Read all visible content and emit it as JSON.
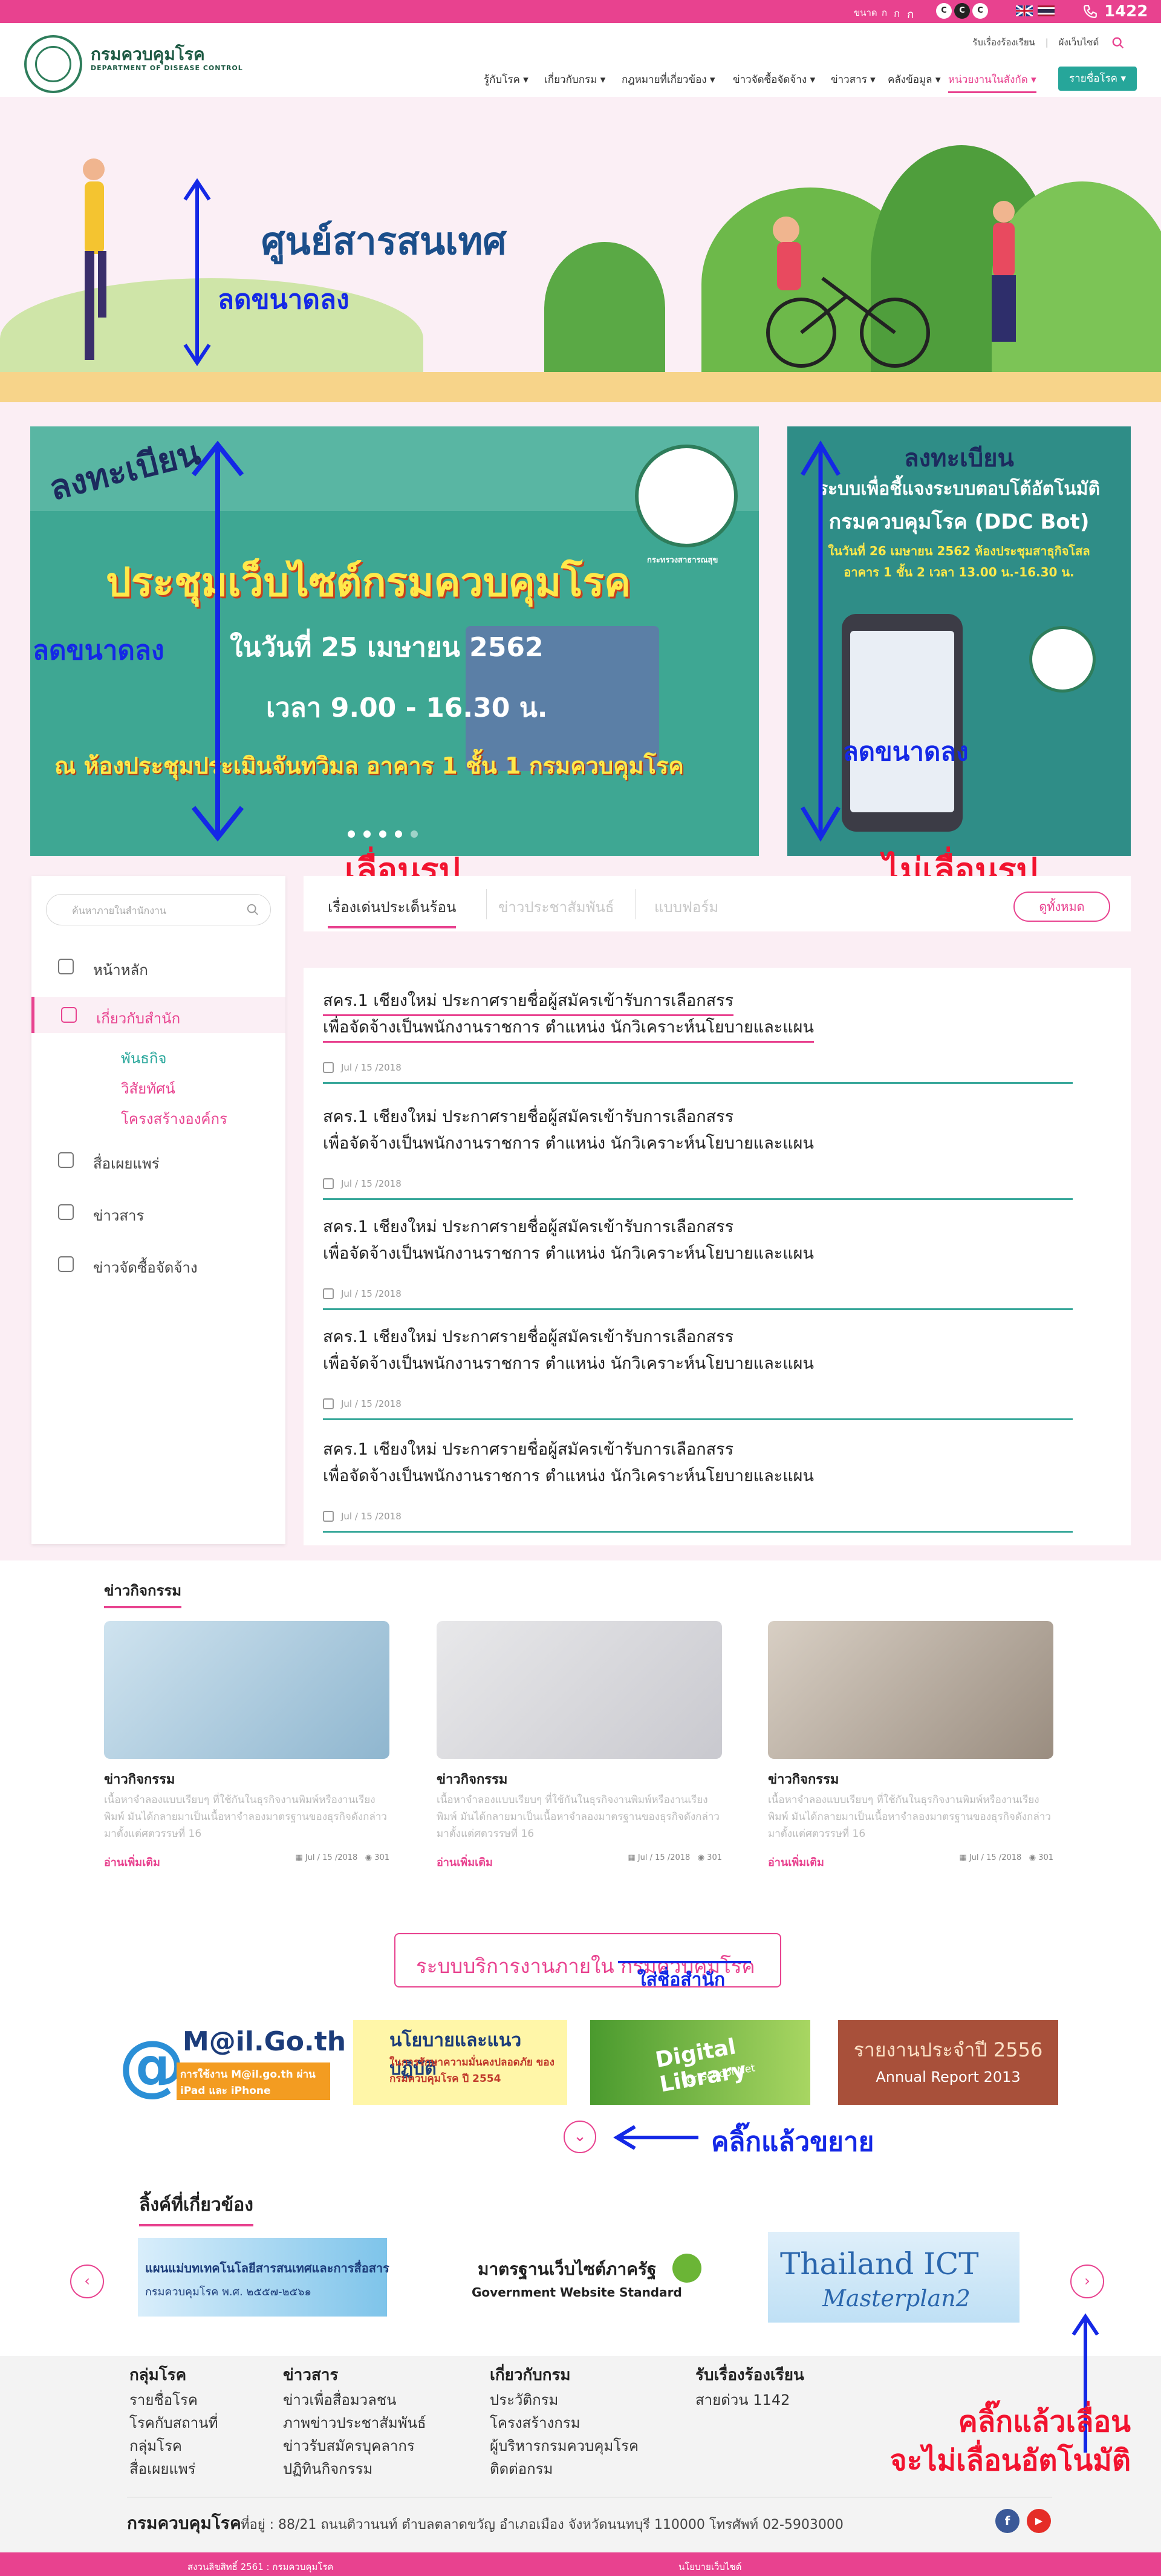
{
  "topbar": {
    "font_size_label": "ขนาด",
    "font_a1": "ก",
    "font_a2": "ก",
    "font_a3": "ก",
    "hotline": "1422",
    "colors": {
      "bar": "#e8428f"
    }
  },
  "header": {
    "logo_th": "กรมควบคุมโรค",
    "logo_en": "DEPARTMENT OF DISEASE CONTROL",
    "link_complaint": "รับเรื่องร้องเรียน",
    "link_sitemap": "ผังเว็บไซต์",
    "nav": [
      "รู้กับโรค",
      "เกี่ยวกับกรม",
      "กฎหมายที่เกี่ยวข้อง",
      "ข่าวจัดซื้อจัดจ้าง",
      "ข่าวสาร",
      "คลังข้อมูล",
      "หน่วยงานในสังกัด"
    ],
    "nav_button": "รายชื่อโรค"
  },
  "hero": {
    "title": "ศูนย์สารสนเทศ",
    "annotation": "ลดขนาดลง"
  },
  "banner_main": {
    "register": "ลงทะเบียน",
    "title": "ประชุมเว็บไซต์กรมควบคุมโรค",
    "date": "ในวันที่ 25 เมษายน 2562",
    "time": "เวลา 9.00 - 16.30 น.",
    "place": "ณ ห้องประชุมประเมินจันทวิมล อาคาร 1 ชั้น 1 กรมควบคุมโรค",
    "seal_text": "กระทรวงสาธารณสุข",
    "annotation_left": "ลดขนาดลง",
    "annotation_below": "เลื่อนรูป"
  },
  "banner_side": {
    "line1": "ลงทะเบียน",
    "line2": "ระบบเพื่อชี้แจงระบบตอบโต้อัตโนมัติ",
    "line3": "กรมควบคุมโรค (DDC Bot)",
    "line4": "ในวันที่ 26 เมษายน 2562 ห้องประชุมสาธุกิจโสล",
    "line5": "อาคาร 1 ชั้น 2 เวลา 13.00 น.-16.30 น.",
    "annotation_mid": "ลดขนาดลง",
    "annotation_below": "ไม่เลื่อนรูป"
  },
  "sidebar": {
    "search_placeholder": "ค้นหาภายในสำนักงาน",
    "items": [
      {
        "label": "หน้าหลัก",
        "icon": "home-icon"
      },
      {
        "label": "เกี่ยวกับสำนัก",
        "icon": "document-icon",
        "active": true
      },
      {
        "label": "สื่อเผยแพร่",
        "icon": "media-icon"
      },
      {
        "label": "ข่าวสาร",
        "icon": "news-icon"
      },
      {
        "label": "ข่าวจัดซื้อจัดจ้าง",
        "icon": "clipboard-icon"
      }
    ],
    "subitems": [
      "พันธกิจ",
      "วิสัยทัศน์",
      "โครงสร้างองค์กร"
    ]
  },
  "tabs": {
    "items": [
      "เรื่องเด่นประเด็นร้อน",
      "ข่าวประชาสัมพันธ์",
      "แบบฟอร์ม"
    ],
    "see_all": "ดูทั้งหมด"
  },
  "news": [
    {
      "line1": "สคร.1 เชียงใหม่ ประกาศรายชื่อผู้สมัครเข้ารับการเลือกสรร",
      "line2": "เพื่อจัดจ้างเป็นพนักงานราชการ ตำแหน่ง นักวิเคราะห์นโยบายและแผน",
      "date": "Jul / 15 /2018"
    },
    {
      "line1": "สคร.1 เชียงใหม่ ประกาศรายชื่อผู้สมัครเข้ารับการเลือกสรร",
      "line2": "เพื่อจัดจ้างเป็นพนักงานราชการ ตำแหน่ง นักวิเคราะห์นโยบายและแผน",
      "date": "Jul / 15 /2018"
    },
    {
      "line1": "สคร.1 เชียงใหม่ ประกาศรายชื่อผู้สมัครเข้ารับการเลือกสรร",
      "line2": "เพื่อจัดจ้างเป็นพนักงานราชการ ตำแหน่ง นักวิเคราะห์นโยบายและแผน",
      "date": "Jul / 15 /2018"
    },
    {
      "line1": "สคร.1 เชียงใหม่ ประกาศรายชื่อผู้สมัครเข้ารับการเลือกสรร",
      "line2": "เพื่อจัดจ้างเป็นพนักงานราชการ ตำแหน่ง นักวิเคราะห์นโยบายและแผน",
      "date": "Jul / 15 /2018"
    },
    {
      "line1": "สคร.1 เชียงใหม่ ประกาศรายชื่อผู้สมัครเข้ารับการเลือกสรร",
      "line2": "เพื่อจัดจ้างเป็นพนักงานราชการ ตำแหน่ง นักวิเคราะห์นโยบายและแผน",
      "date": "Jul / 15 /2018"
    }
  ],
  "activities": {
    "section_title": "ข่าวกิจกรรม",
    "cards": [
      {
        "title": "ข่าวกิจกรรม",
        "desc": "เนื้อหาจำลองแบบเรียบๆ ที่ใช้กันในธุรกิจงานพิมพ์หรืองานเรียงพิมพ์ มันได้กลายมาเป็นเนื้อหาจำลองมาตรฐานของธุรกิจดังกล่าวมาตั้งแต่ศตวรรษที่ 16",
        "more": "อ่านเพิ่มเติม",
        "date": "Jul / 15 /2018",
        "views": "301"
      },
      {
        "title": "ข่าวกิจกรรม",
        "desc": "เนื้อหาจำลองแบบเรียบๆ ที่ใช้กันในธุรกิจงานพิมพ์หรืองานเรียงพิมพ์ มันได้กลายมาเป็นเนื้อหาจำลองมาตรฐานของธุรกิจดังกล่าวมาตั้งแต่ศตวรรษที่ 16",
        "more": "อ่านเพิ่มเติม",
        "date": "Jul / 15 /2018",
        "views": "301"
      },
      {
        "title": "ข่าวกิจกรรม",
        "desc": "เนื้อหาจำลองแบบเรียบๆ ที่ใช้กันในธุรกิจงานพิมพ์หรืองานเรียงพิมพ์ มันได้กลายมาเป็นเนื้อหาจำลองมาตรฐานของธุรกิจดังกล่าวมาตั้งแต่ศตวรรษที่ 16",
        "more": "อ่านเพิ่มเติม",
        "date": "Jul / 15 /2018",
        "views": "301"
      }
    ]
  },
  "services": {
    "title_prefix": "ระบบบริการงานภายใน",
    "title_struck": "กรมควบคุมโรค",
    "annotation_name": "ใส่ชื่อสำนัก",
    "annotation_expand": "คลิ๊กแล้วขยาย",
    "banners": [
      {
        "t1": "M@il.Go.th",
        "t2": "การใช้งาน M@il.go.th ผ่าน iPad และ iPhone"
      },
      {
        "t1": "นโยบายและแนวปฏิบัติ",
        "t2": "ในการรักษาความมั่นคงปลอดภัย ของกรมควบคุมโรค ปี 2554"
      },
      {
        "t1": "Digital Library",
        "t2": "For School Net"
      },
      {
        "t1": "รายงานประจำปี 2556",
        "t2": "Annual Report 2013"
      }
    ]
  },
  "links": {
    "title": "ลิ้งค์ที่เกี่ยวข้อง",
    "items": [
      {
        "t1": "แผนแม่บทเทคโนโลยีสารสนเทศและการสื่อสาร",
        "t2": "กรมควบคุมโรค พ.ศ. ๒๕๕๗-๒๕๖๑"
      },
      {
        "t1": "มาตรฐานเว็บไซต์ภาครัฐ",
        "t2": "Government Website Standard"
      },
      {
        "t1": "Thailand ICT",
        "t2": "Masterplan2"
      }
    ],
    "annotation_line1": "คลิ๊กแล้วเลื่อน",
    "annotation_line2": "จะไม่เลื่อนอัตโนมัติ"
  },
  "footer": {
    "cols": [
      {
        "head": "กลุ่มโรค",
        "items": [
          "รายชื่อโรค",
          "โรคกับสถานที่",
          "กลุ่มโรค",
          "สื่อเผยแพร่"
        ]
      },
      {
        "head": "ข่าวสาร",
        "items": [
          "ข่าวเพื่อสื่อมวลชน",
          "ภาพข่าวประชาสัมพันธ์",
          "ข่าวรับสมัครบุคลากร",
          "ปฏิทินกิจกรรม"
        ]
      },
      {
        "head": "เกี่ยวกับกรม",
        "items": [
          "ประวัติกรม",
          "โครงสร้างกรม",
          "ผู้บริหารกรมควบคุมโรค",
          "ติดต่อกรม"
        ]
      },
      {
        "head": "รับเรื่องร้องเรียน",
        "items": [
          "สายด่วน 1142"
        ]
      }
    ],
    "org": "กรมควบคุมโรค",
    "address": "ที่อยู่ : 88/21 ถนนติวานนท์ ตำบลตลาดขวัญ อำเภอเมือง จังหวัดนนทบุรี 110000 โทรศัพท์ 02-5903000",
    "facebook_glyph": "f",
    "youtube_glyph": "▶",
    "copyright": "สงวนลิขสิทธิ์ 2561 : กรมควบคุมโรค",
    "policy": "นโยบายเว็บไซต์"
  }
}
